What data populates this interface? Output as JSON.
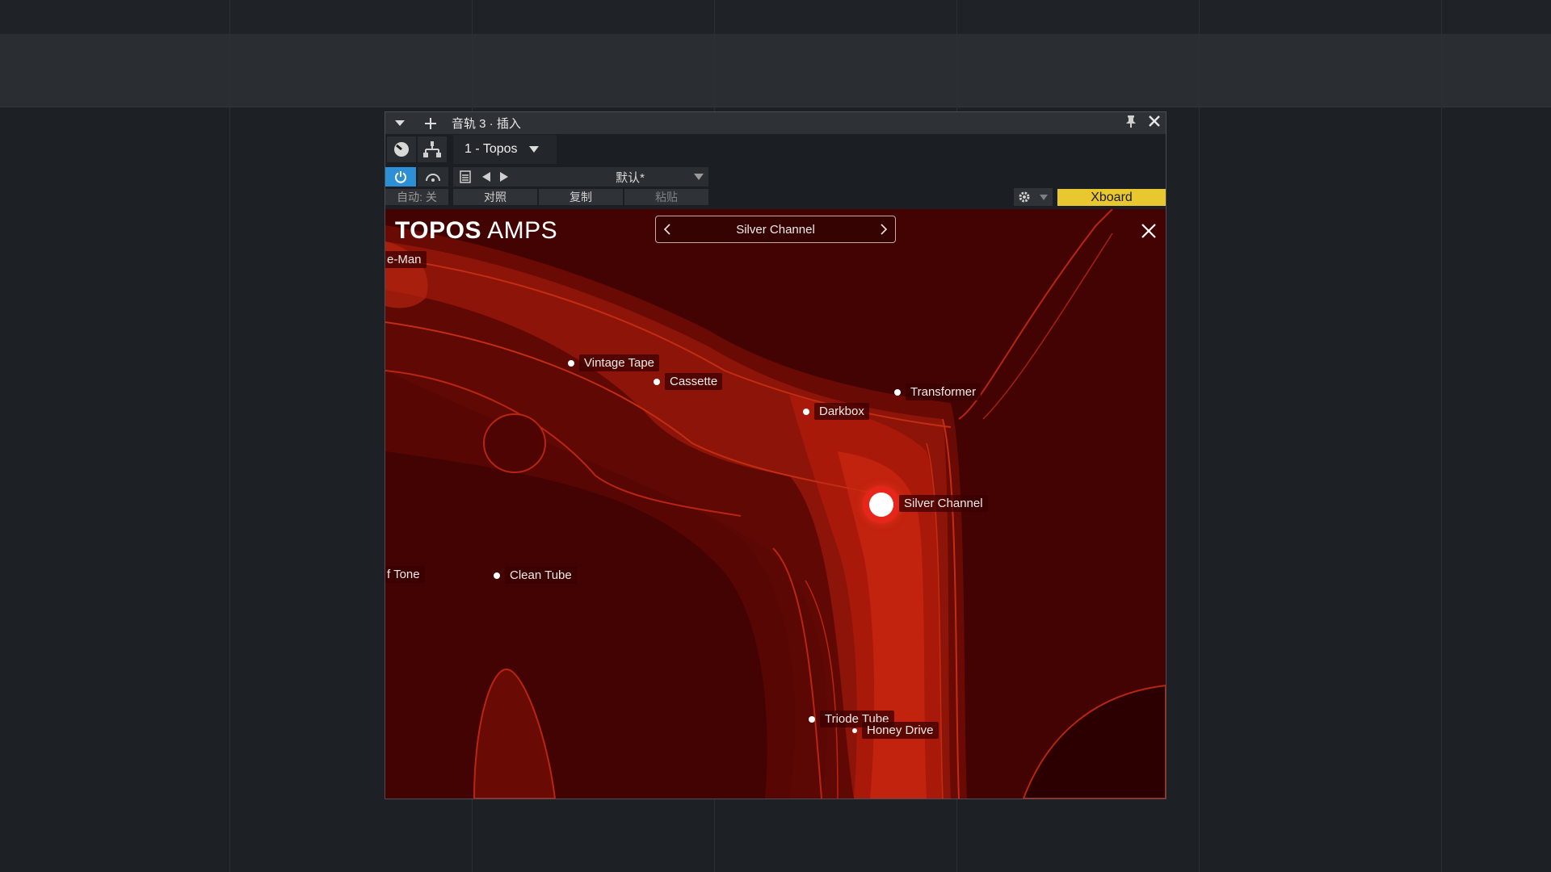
{
  "window": {
    "title": "音轨 3 · 插入",
    "preset_tab": "1 - Topos",
    "preset_name": "默认*",
    "auto_label": "自动: 关",
    "compare_label": "对照",
    "copy_label": "复制",
    "paste_label": "粘贴",
    "xboard_label": "Xboard"
  },
  "plugin": {
    "logo_bold": "TOPOS",
    "logo_light": "AMPS",
    "selected_model": "Silver Channel"
  },
  "map_points": [
    {
      "name": "e-Man"
    },
    {
      "name": "Vintage Tape"
    },
    {
      "name": "Cassette"
    },
    {
      "name": "Transformer"
    },
    {
      "name": "Darkbox"
    },
    {
      "name": "Silver Channel"
    },
    {
      "name": "f Tone"
    },
    {
      "name": "Clean Tube"
    },
    {
      "name": "Triode Tube"
    },
    {
      "name": "Honey Drive"
    }
  ],
  "colors": {
    "accent_blue": "#2d8fd6",
    "xboard_yellow": "#e9c82f",
    "map_dark": "#3a0000",
    "map_hot": "#d22a14"
  }
}
